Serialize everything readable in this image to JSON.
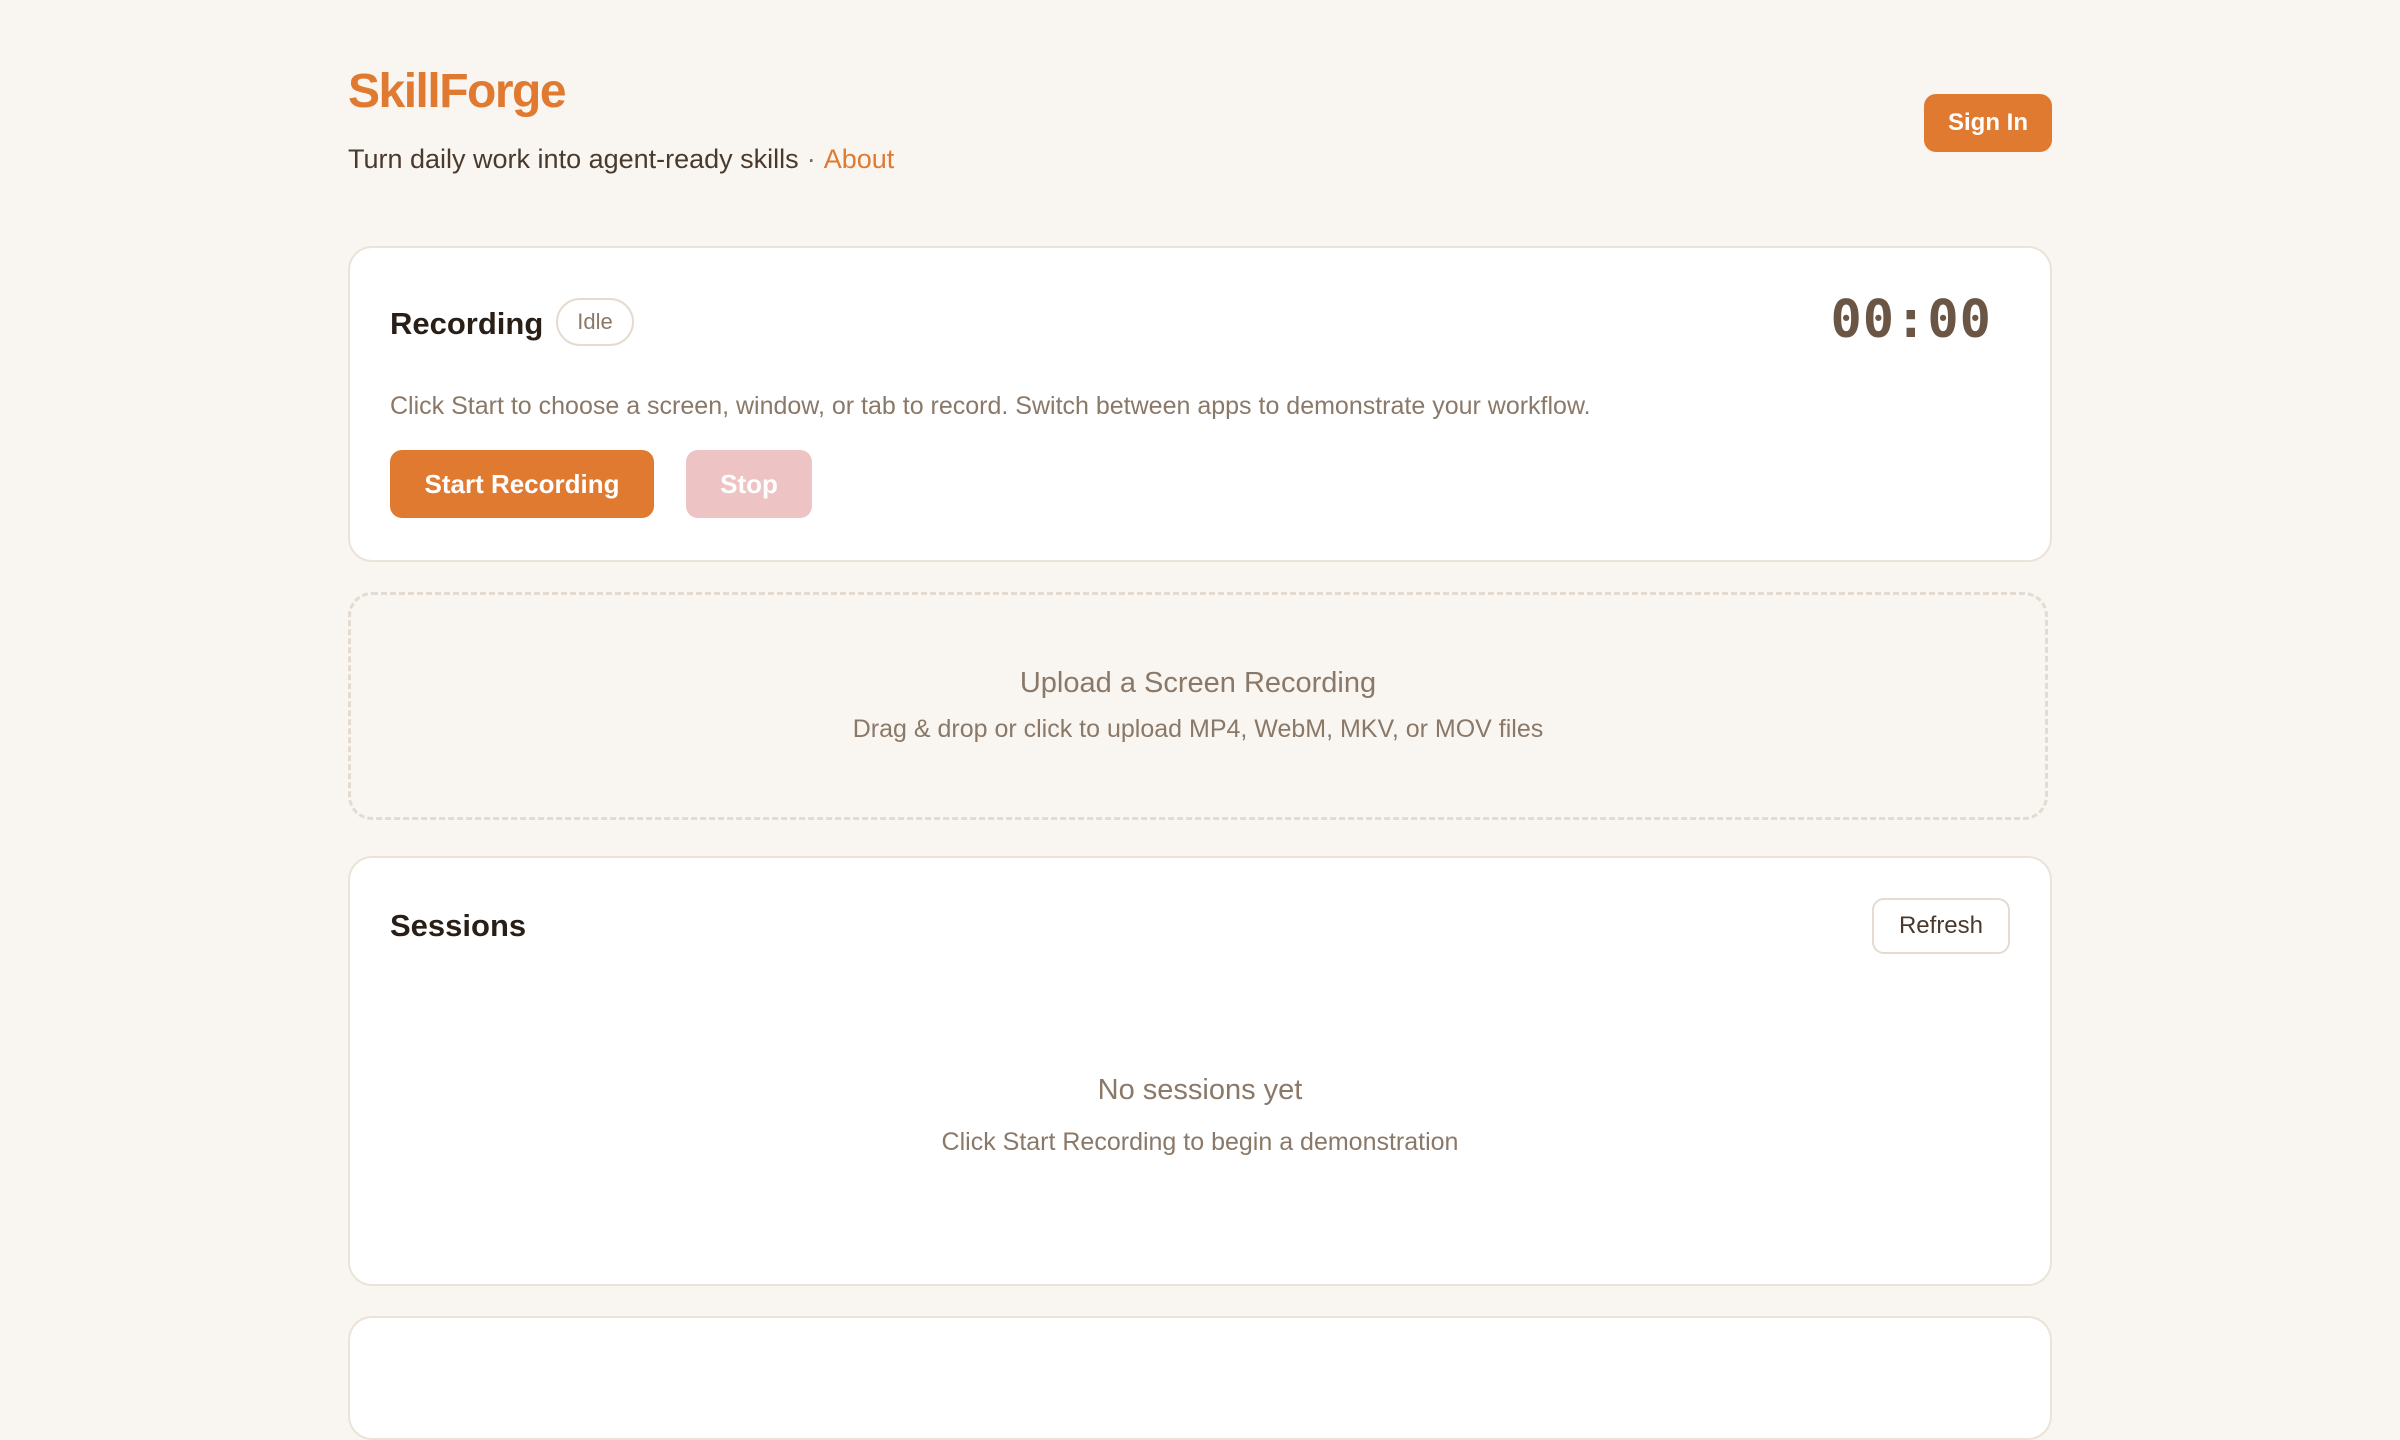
{
  "header": {
    "brand": "SkillForge",
    "tagline": "Turn daily work into agent-ready skills",
    "separator": "·",
    "about_link": "About",
    "sign_in_label": "Sign In"
  },
  "recording": {
    "title": "Recording",
    "status": "Idle",
    "timer": "00:00",
    "description": "Click Start to choose a screen, window, or tab to record. Switch between apps to demonstrate your workflow.",
    "start_label": "Start Recording",
    "stop_label": "Stop",
    "stop_disabled": true
  },
  "upload": {
    "title": "Upload a Screen Recording",
    "subtitle": "Drag & drop or click to upload MP4, WebM, MKV, or MOV files"
  },
  "sessions": {
    "title": "Sessions",
    "refresh_label": "Refresh",
    "empty_title": "No sessions yet",
    "empty_subtitle": "Click Start Recording to begin a demonstration"
  },
  "colors": {
    "accent": "#e07a30",
    "background": "#f9f6f1",
    "stop_disabled": "#eec3c3",
    "muted_text": "#8a7868"
  }
}
